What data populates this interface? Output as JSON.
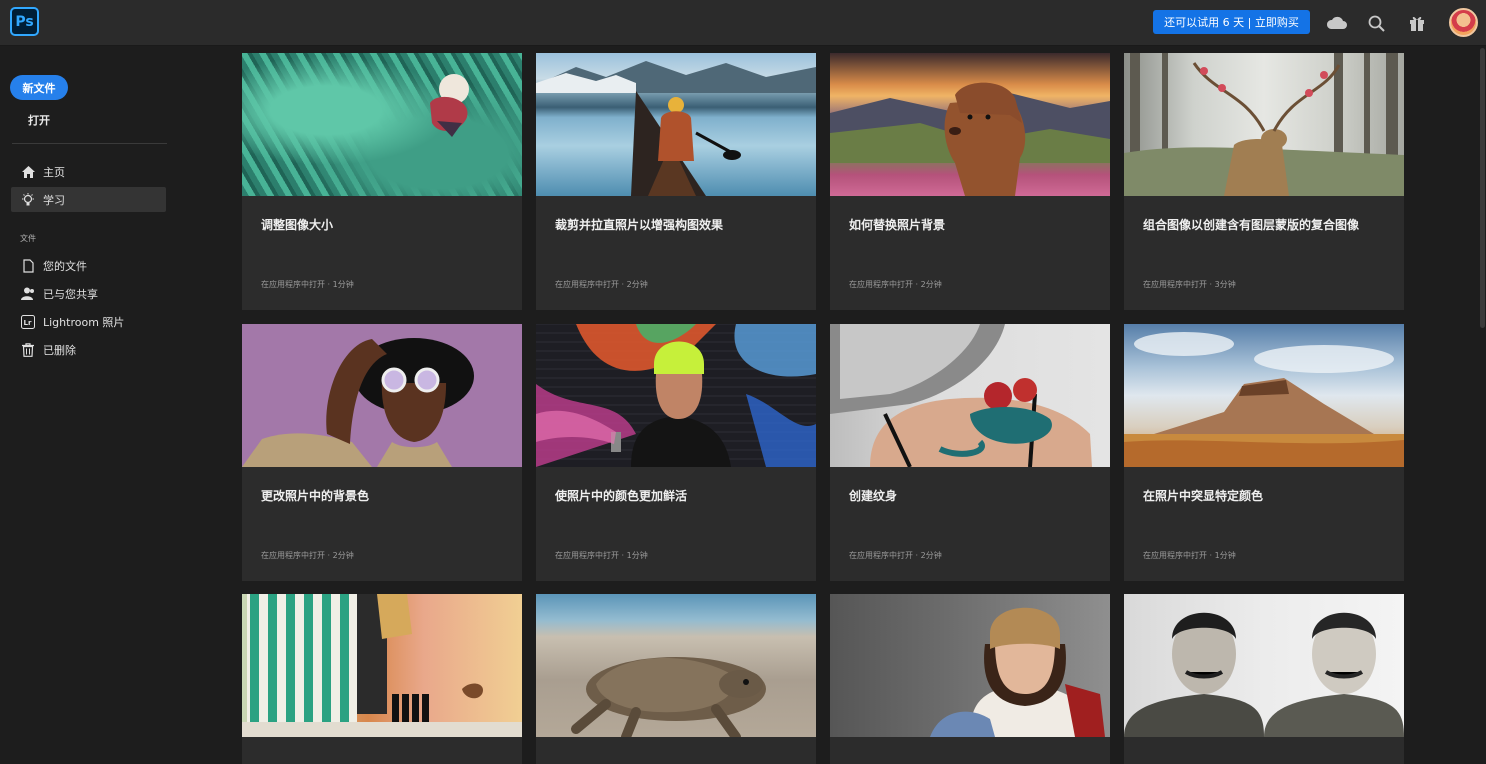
{
  "app": {
    "logo_text": "Ps"
  },
  "header": {
    "trial_button": "还可以试用 6 天 | 立即购买"
  },
  "sidebar": {
    "new_file": "新文件",
    "open": "打开",
    "nav": [
      {
        "label": "主页",
        "icon": "home-icon"
      },
      {
        "label": "学习",
        "icon": "lightbulb-icon"
      }
    ],
    "files_section": "文件",
    "file_nav": [
      {
        "label": "您的文件",
        "icon": "document-icon"
      },
      {
        "label": "已与您共享",
        "icon": "shared-users-icon"
      },
      {
        "label": "Lightroom 照片",
        "icon": "lightroom-icon"
      },
      {
        "label": "已删除",
        "icon": "trash-icon"
      }
    ]
  },
  "tutorials": [
    {
      "title": "调整图像大小",
      "meta": "在应用程序中打开 · 1分钟"
    },
    {
      "title": "裁剪并拉直照片以增强构图效果",
      "meta": "在应用程序中打开 · 2分钟"
    },
    {
      "title": "如何替换照片背景",
      "meta": "在应用程序中打开 · 2分钟"
    },
    {
      "title": "组合图像以创建含有图层蒙版的复合图像",
      "meta": "在应用程序中打开 · 3分钟"
    },
    {
      "title": "更改照片中的背景色",
      "meta": "在应用程序中打开 · 2分钟"
    },
    {
      "title": "使照片中的颜色更加鲜活",
      "meta": "在应用程序中打开 · 1分钟"
    },
    {
      "title": "创建纹身",
      "meta": "在应用程序中打开 · 2分钟"
    },
    {
      "title": "在照片中突显特定颜色",
      "meta": "在应用程序中打开 · 1分钟"
    }
  ],
  "colors": {
    "accent": "#1473e6",
    "new_button": "#2680eb",
    "card_bg": "#2c2c2c",
    "app_bg": "#1d1d1d"
  }
}
